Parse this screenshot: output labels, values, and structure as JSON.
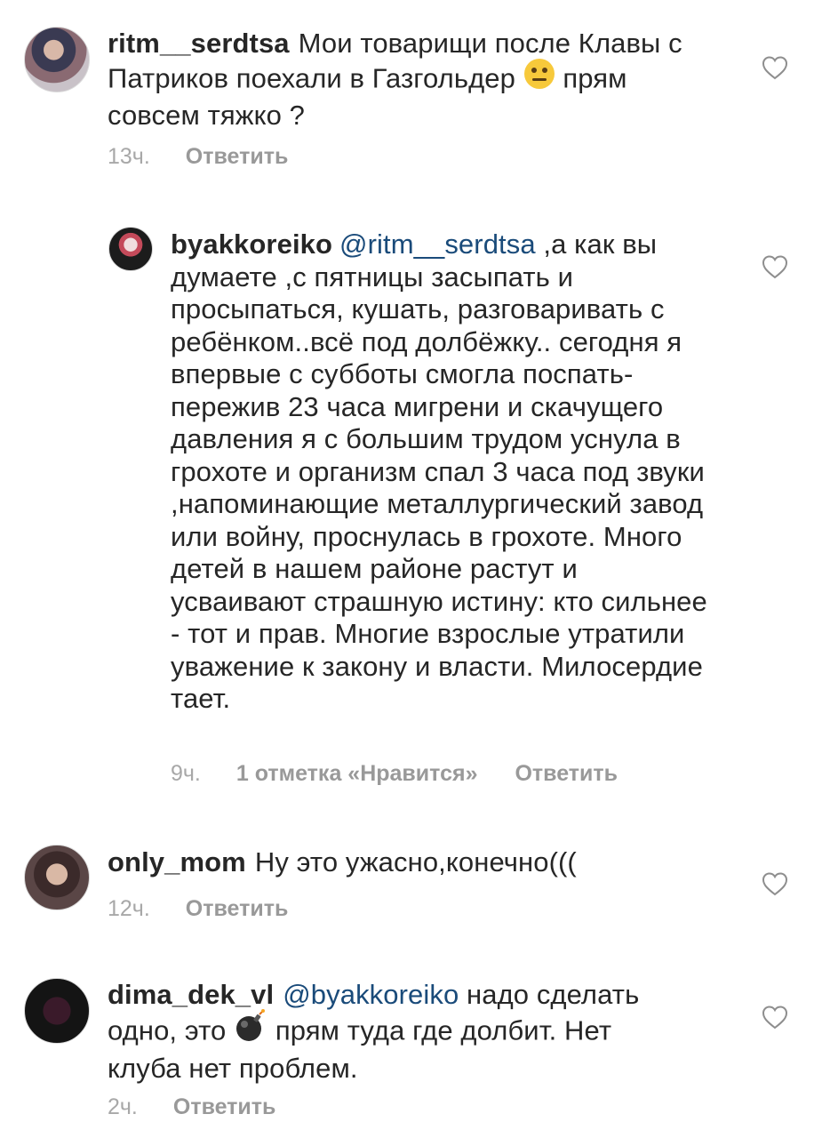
{
  "comments": [
    {
      "username": "ritm__serdtsa",
      "text_a": "Мои товарищи после Клавы с Патриков поехали в Газгольдер",
      "emoji": "neutral-face-emoji",
      "text_b": "прям совсем тяжко ?",
      "time": "13ч.",
      "reply_label": "Ответить"
    },
    {
      "username": "byakkoreiko",
      "mention": "@ritm__serdtsa",
      "text": " ,а как вы думаете ,с пятницы засыпать и просыпаться, кушать, разговаривать с ребёнком..всё под долбёжку.. сегодня я впервые с субботы смогла поспать- пережив 23 часа мигрени и скачущего давления я с большим трудом уснула в грохоте и организм спал 3 часа под звуки ,напоминающие металлургический завод или войну, проснулась в грохоте.  Много детей в нашем районе растут и усваивают страшную истину: кто сильнее - тот и прав. Многие взрослые утратили уважение к закону и власти. Милосердие тает.",
      "time": "9ч.",
      "likes_label": "1 отметка «Нравится»",
      "reply_label": "Ответить"
    },
    {
      "username": "only_mom",
      "text": "Ну это ужасно,конечно(((",
      "time": "12ч.",
      "reply_label": "Ответить"
    },
    {
      "username": "dima_dek_vl",
      "mention": "@byakkoreiko",
      "text_a": "  надо сделать одно, это",
      "emoji": "bomb-emoji",
      "text_b": "прям туда где долбит. Нет клуба нет проблем.",
      "time": "2ч.",
      "reply_label": "Ответить"
    }
  ],
  "colors": {
    "mention": "#1a4b7a",
    "meta": "#999999",
    "heart": "#8e8e8e"
  }
}
